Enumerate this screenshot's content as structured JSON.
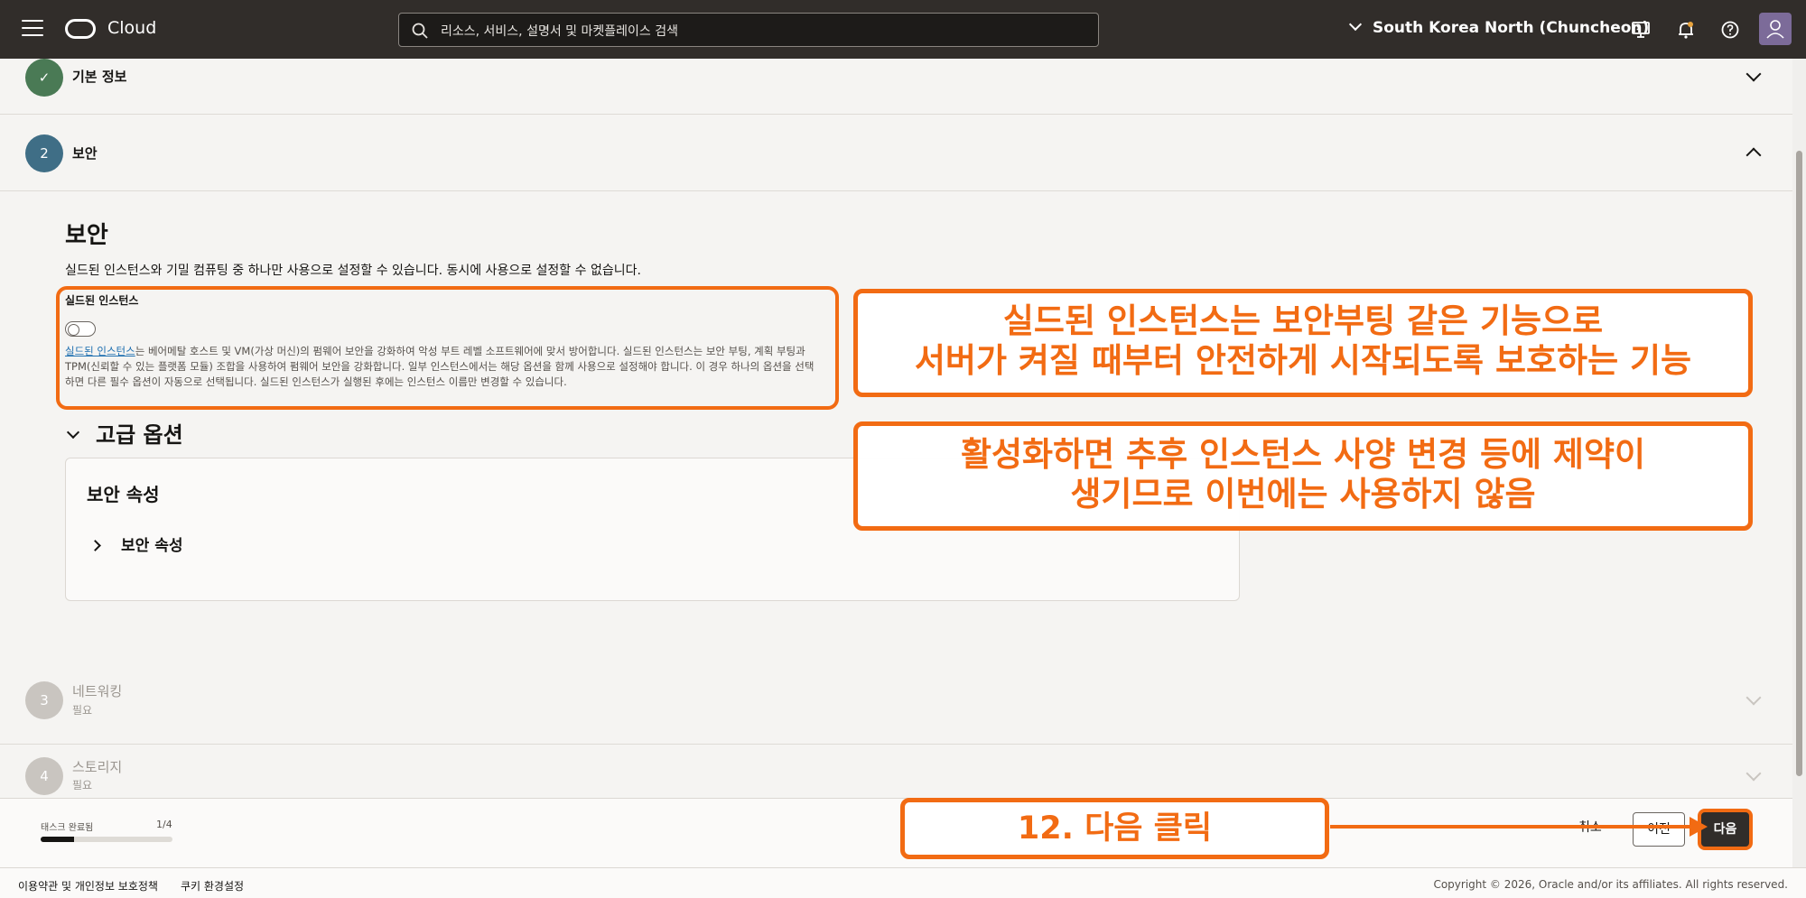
{
  "header": {
    "brand": "Cloud",
    "search_placeholder": "리소스, 서비스, 설명서 및 마켓플레이스 검색",
    "region": "South Korea North (Chuncheon)"
  },
  "steps": [
    {
      "number": "✓",
      "title": "기본 정보",
      "status": "done"
    },
    {
      "number": "2",
      "title": "보안",
      "status": "active"
    },
    {
      "number": "3",
      "title": "네트워킹",
      "subtitle": "필요",
      "status": "pending"
    },
    {
      "number": "4",
      "title": "스토리지",
      "subtitle": "필요",
      "status": "pending"
    }
  ],
  "security": {
    "title": "보안",
    "description": "실드된 인스턴스와 기밀 컴퓨팅 중 하나만 사용으로 설정할 수 있습니다. 동시에 사용으로 설정할 수 없습니다.",
    "shielded_label": "실드된 인스턴스",
    "shielded_toggle": "off",
    "shielded_link": "실드된 인스턴스",
    "shielded_help": "는 베어메탈 호스트 및 VM(가상 머신)의 펌웨어 보안을 강화하여 악성 부트 레벨 소프트웨어에 맞서 방어합니다. 실드된 인스턴스는 보안 부팅, 계획 부팅과 TPM(신뢰할 수 있는 플랫폼 모듈) 조합을 사용하여 펌웨어 보안을 강화합니다. 일부 인스턴스에서는 해당 옵션을 함께 사용으로 설정해야 합니다. 이 경우 하나의 옵션을 선택하면 다른 필수 옵션이 자동으로 선택됩니다. 실드된 인스턴스가 실행된 후에는 인스턴스 이름만 변경할 수 있습니다.",
    "advanced_options": "고급 옵션",
    "panel_title": "보안 속성",
    "panel_item": "보안 속성"
  },
  "annotations": {
    "box1": [
      "실드된 인스턴스는 보안부팅 같은 기능으로",
      "서버가 켜질 때부터 안전하게 시작되도록 보호하는 기능"
    ],
    "box2": [
      "활성화하면 추후 인스턴스 사양 변경 등에 제약이",
      "생기므로 이번에는 사용하지 않음"
    ],
    "box3": "12. 다음 클릭",
    "accent_color": "#f26b13"
  },
  "actions": {
    "progress_label": "태스크 완료됨",
    "progress_count": "1/4",
    "progress_fraction": 0.25,
    "cancel": "취소",
    "prev": "이전",
    "next": "다음"
  },
  "footer": {
    "terms": "이용약관 및 개인정보 보호정책",
    "cookies": "쿠키 환경설정",
    "copyright": "Copyright © 2026, Oracle and/or its affiliates. All rights reserved."
  }
}
